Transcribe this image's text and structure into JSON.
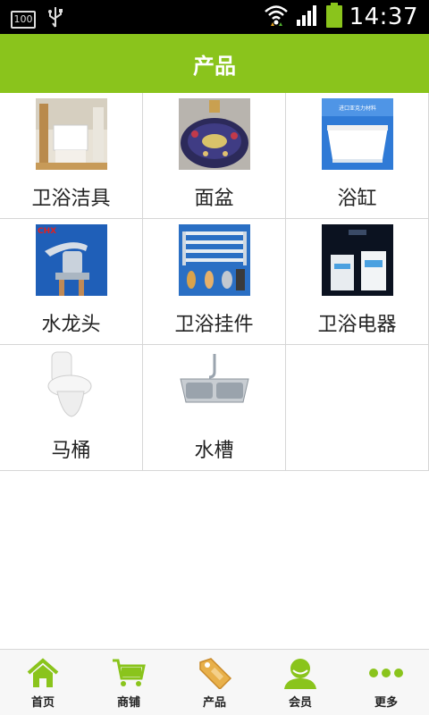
{
  "status_bar": {
    "battery_level": "100",
    "time": "14:37",
    "icons": [
      "battery-box-icon",
      "usb-icon",
      "wifi-icon",
      "signal-icon",
      "battery-icon"
    ]
  },
  "header": {
    "title": "产品"
  },
  "colors": {
    "accent": "#8ac41c",
    "nav_icon": "#8ac41c",
    "tag_icon": "#e8b04a"
  },
  "products": [
    {
      "label": "卫浴洁具",
      "image": "sanitary-ware-photo"
    },
    {
      "label": "面盆",
      "image": "basin-photo"
    },
    {
      "label": "浴缸",
      "image": "bathtub-photo",
      "image_text": "进口亚克力材料"
    },
    {
      "label": "水龙头",
      "image": "faucet-photo",
      "image_text": "CHX"
    },
    {
      "label": "卫浴挂件",
      "image": "towel-rack-photo"
    },
    {
      "label": "卫浴电器",
      "image": "water-heater-photo"
    },
    {
      "label": "马桶",
      "image": "toilet-photo"
    },
    {
      "label": "水槽",
      "image": "sink-photo"
    }
  ],
  "bottom_nav": [
    {
      "label": "首页",
      "icon": "home-icon"
    },
    {
      "label": "商铺",
      "icon": "cart-icon"
    },
    {
      "label": "产品",
      "icon": "tag-icon"
    },
    {
      "label": "会员",
      "icon": "user-icon"
    },
    {
      "label": "更多",
      "icon": "more-icon"
    }
  ]
}
